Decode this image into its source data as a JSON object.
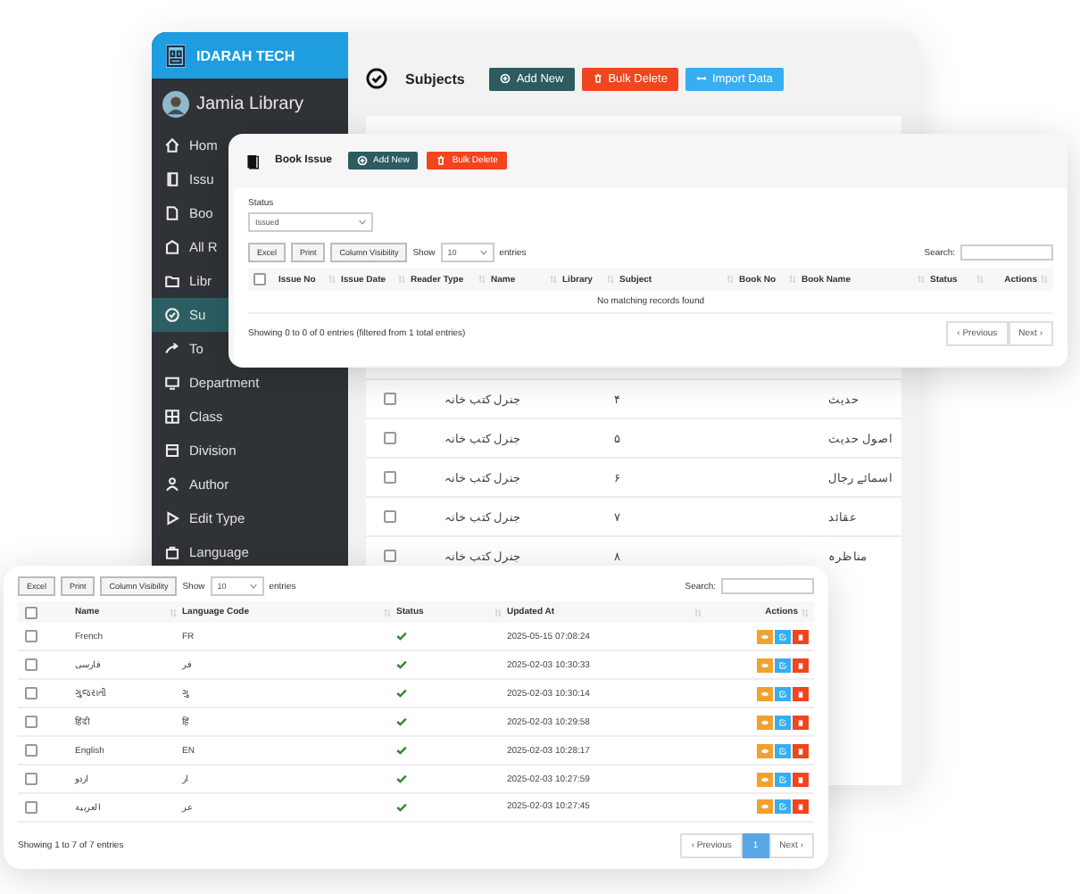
{
  "back_window": {
    "brand": "IDARAH TECH",
    "user": "Jamia Library",
    "sidebar": {
      "items": [
        {
          "label": "Hom",
          "selected": false
        },
        {
          "label": "Issu",
          "selected": false
        },
        {
          "label": "Boo",
          "selected": false
        },
        {
          "label": "All R",
          "selected": false
        },
        {
          "label": "Libr",
          "selected": false
        },
        {
          "label": "Su",
          "selected": true
        },
        {
          "label": "To",
          "selected": false
        },
        {
          "label": "Department",
          "selected": false
        },
        {
          "label": "Class",
          "selected": false
        },
        {
          "label": "Division",
          "selected": false
        },
        {
          "label": "Author",
          "selected": false
        },
        {
          "label": "Edit Type",
          "selected": false
        },
        {
          "label": "Language",
          "selected": false
        }
      ]
    },
    "page_title": "Subjects",
    "actions": [
      {
        "label": "Add New",
        "kind": "add"
      },
      {
        "label": "Bulk Delete",
        "kind": "delete"
      },
      {
        "label": "Import Data",
        "kind": "import"
      }
    ],
    "table": {
      "rows": [
        {
          "checked": false,
          "library": "جنرل کتب خانہ",
          "column_3": "۴",
          "name": "حدیث"
        },
        {
          "checked": false,
          "library": "جنرل کتب خانہ",
          "column_3": "۵",
          "name": "اصول حدیث"
        },
        {
          "checked": false,
          "library": "جنرل کتب خانہ",
          "column_3": "۶",
          "name": "اسمائے رجال"
        },
        {
          "checked": false,
          "library": "جنرل کتب خانہ",
          "column_3": "۷",
          "name": "عقائد"
        },
        {
          "checked": false,
          "library": "جنرل کتب خانہ",
          "column_3": "۸",
          "name": "مناظرہ"
        }
      ]
    }
  },
  "book_issue": {
    "title": "Book Issue",
    "actions": [
      {
        "label": "Add New",
        "kind": "add"
      },
      {
        "label": "Bulk Delete",
        "kind": "delete"
      }
    ],
    "status_filter": {
      "label": "Status",
      "value": "Issued"
    },
    "toolbar": {
      "buttons": [
        "Excel",
        "Print",
        "Column Visibility"
      ],
      "show_label": "Show",
      "page_size": "10",
      "entries_label": "entries",
      "search_label": "Search:"
    },
    "table": {
      "select_all": {
        "checked": false
      },
      "columns": [
        "Issue No",
        "Issue Date",
        "Reader Type",
        "Name",
        "Library",
        "Subject",
        "Book No",
        "Book Name",
        "Status",
        "Actions"
      ],
      "empty_message": "No matching records found"
    },
    "info": "Showing 0 to 0 of 0 entries (filtered from 1 total entries)",
    "pagination": {
      "previous": "‹ Previous",
      "next": "Next ›"
    }
  },
  "languages": {
    "toolbar": {
      "buttons": [
        "Excel",
        "Print",
        "Column Visibility"
      ],
      "show_label": "Show",
      "page_size": "10",
      "entries_label": "entries",
      "search_label": "Search:"
    },
    "table": {
      "select_all": {
        "checked": false
      },
      "columns": [
        "Name",
        "Language Code",
        "Status",
        "Updated At",
        "Actions"
      ],
      "rows": [
        {
          "checked": false,
          "name": "French",
          "code": "FR",
          "active": true,
          "updated_at": "2025-05-15 07:08:24"
        },
        {
          "checked": false,
          "name": "فارسی",
          "code": "فر",
          "active": true,
          "updated_at": "2025-02-03 10:30:33"
        },
        {
          "checked": false,
          "name": "ગુજરાતી",
          "code": "ગુ",
          "active": true,
          "updated_at": "2025-02-03 10:30:14"
        },
        {
          "checked": false,
          "name": "हिंदी",
          "code": "हिं",
          "active": true,
          "updated_at": "2025-02-03 10:29:58"
        },
        {
          "checked": false,
          "name": "English",
          "code": "EN",
          "active": true,
          "updated_at": "2025-02-03 10:28:17"
        },
        {
          "checked": false,
          "name": "اردو",
          "code": "ار",
          "active": true,
          "updated_at": "2025-02-03 10:27:59"
        },
        {
          "checked": false,
          "name": "العربية",
          "code": "عر",
          "active": true,
          "updated_at": "2025-02-03 10:27:45"
        }
      ]
    },
    "info": "Showing 1 to 7 of 7 entries",
    "pagination": {
      "previous": "‹ Previous",
      "pages": [
        {
          "label": "1",
          "selected": true
        }
      ],
      "next": "Next ›"
    }
  }
}
